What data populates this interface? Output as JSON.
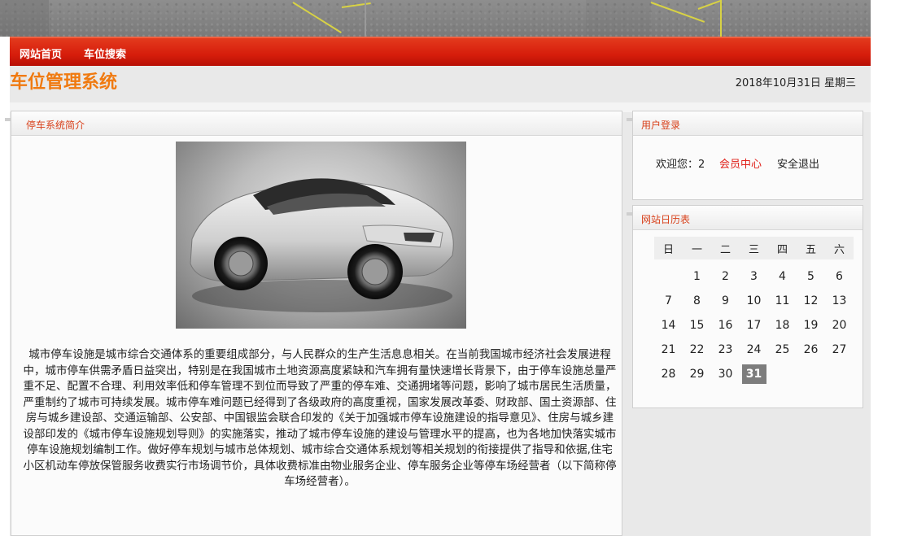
{
  "nav": {
    "items": [
      "网站首页",
      "车位搜索"
    ]
  },
  "header": {
    "site_title": "车位管理系统",
    "date": "2018年10月31日 星期三"
  },
  "intro": {
    "title": "停车系统简介",
    "image_alt": "car-photo",
    "text": "城市停车设施是城市综合交通体系的重要组成部分，与人民群众的生产生活息息相关。在当前我国城市经济社会发展进程中，城市停车供需矛盾日益突出，特别是在我国城市土地资源高度紧缺和汽车拥有量快速增长背景下，由于停车设施总量严重不足、配置不合理、利用效率低和停车管理不到位而导致了严重的停车难、交通拥堵等问题，影响了城市居民生活质量，严重制约了城市可持续发展。城市停车难问题已经得到了各级政府的高度重视，国家发展改革委、财政部、国土资源部、住房与城乡建设部、交通运输部、公安部、中国银监会联合印发的《关于加强城市停车设施建设的指导意见》、住房与城乡建设部印发的《城市停车设施规划导则》的实施落实，推动了城市停车设施的建设与管理水平的提高，也为各地加快落实城市停车设施规划编制工作。做好停车规划与城市总体规划、城市综合交通体系规划等相关规划的衔接提供了指导和依据,住宅小区机动车停放保管服务收费实行市场调节价，具体收费标准由物业服务企业、停车服务企业等停车场经营者（以下简称停车场经营者）。"
  },
  "login": {
    "title": "用户登录",
    "welcome": "欢迎您：2",
    "member_center": "会员中心",
    "logout": "安全退出"
  },
  "calendar": {
    "title": "网站日历表",
    "weekdays": [
      "日",
      "一",
      "二",
      "三",
      "四",
      "五",
      "六"
    ],
    "weeks": [
      [
        "",
        "1",
        "2",
        "3",
        "4",
        "5",
        "6"
      ],
      [
        "7",
        "8",
        "9",
        "10",
        "11",
        "12",
        "13"
      ],
      [
        "14",
        "15",
        "16",
        "17",
        "18",
        "19",
        "20"
      ],
      [
        "21",
        "22",
        "23",
        "24",
        "25",
        "26",
        "27"
      ],
      [
        "28",
        "29",
        "30",
        "31",
        "",
        "",
        ""
      ]
    ],
    "today": "31"
  },
  "colors": {
    "nav_red": "#d61d0b",
    "title_orange": "#f07a10",
    "panel_title_red": "#d8401a",
    "link_red": "#e0201a"
  }
}
